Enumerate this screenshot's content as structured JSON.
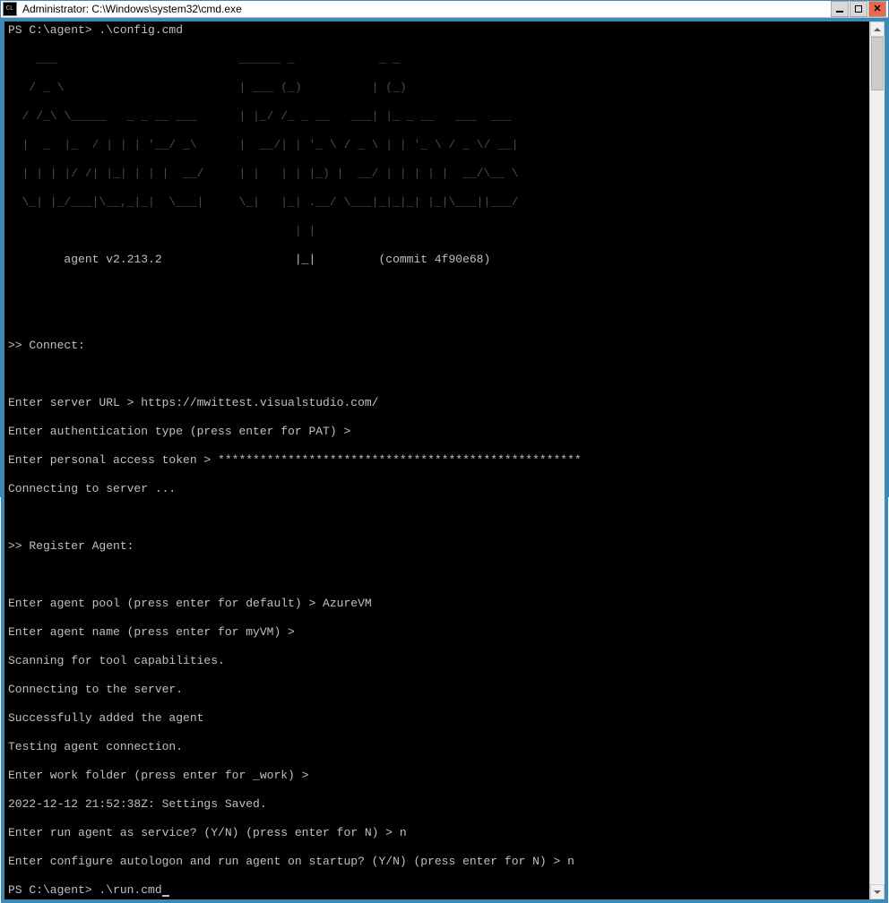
{
  "window": {
    "title": "Administrator: C:\\Windows\\system32\\cmd.exe",
    "icon_label": "CL"
  },
  "prompt1": {
    "ps": "PS C:\\agent> ",
    "cmd": ".\\config.cmd"
  },
  "ascii_art": [
    "    ___                          ______ _            _ _",
    "   / _ \\                         | ___ (_)          | (_)",
    "  / /_\\ \\_____   _ _ __ ___      | |_/ /_ _ __   ___| |_ _ __   ___  ___",
    "  |  _  |_  / | | | '__/ _\\      |  __/| | '_ \\ / _ \\ | | '_ \\ / _ \\/ __|",
    "  | | | |/ /| |_| | | |  __/     | |   | | |_) |  __/ | | | | |  __/\\__ \\",
    "  \\_| |_/___|\\__,_|_|  \\___|     \\_|   |_| .__/ \\___|_|_|_| |_|\\___||___/",
    "                                         | |",
    "        agent v2.213.2                   |_|         (commit 4f90e68)"
  ],
  "sections": {
    "connect_header": ">> Connect:",
    "register_header": ">> Register Agent:"
  },
  "connect_lines": [
    "Enter server URL > https://mwittest.visualstudio.com/",
    "Enter authentication type (press enter for PAT) >",
    "Enter personal access token > ****************************************************",
    "Connecting to server ..."
  ],
  "register_lines": [
    "Enter agent pool (press enter for default) > AzureVM",
    "Enter agent name (press enter for myVM) >",
    "Scanning for tool capabilities.",
    "Connecting to the server.",
    "Successfully added the agent",
    "Testing agent connection.",
    "Enter work folder (press enter for _work) >",
    "2022-12-12 21:52:38Z: Settings Saved.",
    "Enter run agent as service? (Y/N) (press enter for N) > n",
    "Enter configure autologon and run agent on startup? (Y/N) (press enter for N) > n"
  ],
  "prompt2": {
    "ps": "PS C:\\agent> ",
    "cmd": ".\\run.cmd"
  }
}
